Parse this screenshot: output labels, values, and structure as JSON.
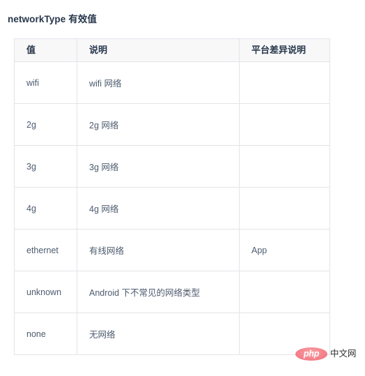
{
  "page": {
    "title": "networkType 有效值",
    "background_color": "#ffffff"
  },
  "table": {
    "border_color": "#e3e4e8",
    "header_background": "#f8f8f9",
    "header_text_color": "#27364b",
    "body_text_color": "#4d5b6e",
    "columns": [
      {
        "key": "value",
        "label": "值"
      },
      {
        "key": "description",
        "label": "说明"
      },
      {
        "key": "platform",
        "label": "平台差异说明"
      }
    ],
    "rows": [
      {
        "value": "wifi",
        "description": "wifi 网络",
        "platform": ""
      },
      {
        "value": "2g",
        "description": "2g 网络",
        "platform": ""
      },
      {
        "value": "3g",
        "description": "3g 网络",
        "platform": ""
      },
      {
        "value": "4g",
        "description": "4g 网络",
        "platform": ""
      },
      {
        "value": "ethernet",
        "description": "有线网络",
        "platform": "App"
      },
      {
        "value": "unknown",
        "description": "Android 下不常见的网络类型",
        "platform": ""
      },
      {
        "value": "none",
        "description": "无网络",
        "platform": ""
      }
    ]
  },
  "watermark": {
    "badge_label": "php",
    "text": "中文网",
    "badge_color": "#ef6d7a"
  }
}
